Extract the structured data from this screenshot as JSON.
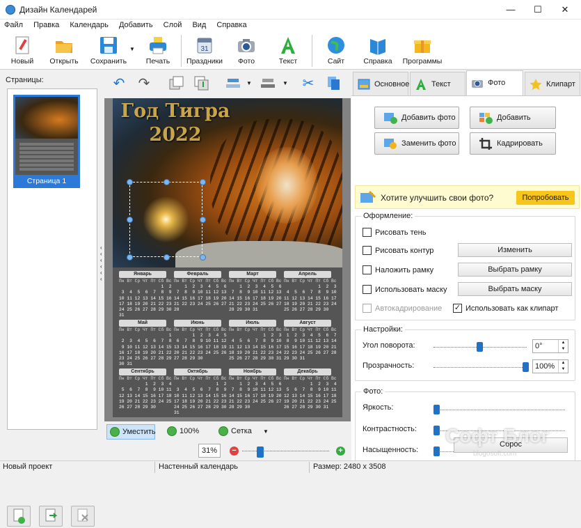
{
  "window": {
    "title": "Дизайн Календарей",
    "minimize": "—",
    "maximize": "☐",
    "close": "✕"
  },
  "menu": [
    "Файл",
    "Правка",
    "Календарь",
    "Добавить",
    "Слой",
    "Вид",
    "Справка"
  ],
  "toolbar": {
    "new": "Новый",
    "open": "Открыть",
    "save": "Сохранить",
    "print": "Печать",
    "holidays": "Праздники",
    "photo": "Фото",
    "text": "Текст",
    "site": "Сайт",
    "help": "Справка",
    "programs": "Программы",
    "holidays_icon_num": "31"
  },
  "pages": {
    "label": "Страницы:",
    "items": [
      {
        "label": "Страница 1"
      }
    ]
  },
  "poster": {
    "title_line1": "Год Тигра",
    "title_line2": "2022"
  },
  "calendar": {
    "weekday_header": "Пн Вт Ср Чт Пт Сб Вс",
    "months": [
      {
        "name": "Январь",
        "days": "                1  2\n 3  4  5  6  7  8  9\n10 11 12 13 14 15 16\n17 18 19 20 21 22 23\n24 25 26 27 28 29 30\n31"
      },
      {
        "name": "Февраль",
        "days": "    1  2  3  4  5  6\n 7  8  9 10 11 12 13\n14 15 16 17 18 19 20\n21 22 23 24 25 26 27\n28"
      },
      {
        "name": "Март",
        "days": "    1  2  3  4  5  6\n 7  8  9 10 11 12 13\n14 15 16 17 18 19 20\n21 22 23 24 25 26 27\n28 29 30 31"
      },
      {
        "name": "Апрель",
        "days": "             1  2  3\n 4  5  6  7  8  9 10\n11 12 13 14 15 16 17\n18 19 20 21 22 23 24\n25 26 27 28 29 30"
      },
      {
        "name": "Май",
        "days": "                   1\n 2  3  4  5  6  7  8\n 9 10 11 12 13 14 15\n16 17 18 19 20 21 22\n23 24 25 26 27 28 29\n30 31"
      },
      {
        "name": "Июнь",
        "days": "       1  2  3  4  5\n 6  7  8  9 10 11 12\n13 14 15 16 17 18 19\n20 21 22 23 24 25 26\n27 28 29 30"
      },
      {
        "name": "Июль",
        "days": "             1  2  3\n 4  5  6  7  8  9 10\n11 12 13 14 15 16 17\n18 19 20 21 22 23 24\n25 26 27 28 29 30 31"
      },
      {
        "name": "Август",
        "days": " 1  2  3  4  5  6  7\n 8  9 10 11 12 13 14\n15 16 17 18 19 20 21\n22 23 24 25 26 27 28\n29 30 31"
      },
      {
        "name": "Сентябрь",
        "days": "          1  2  3  4\n 5  6  7  8  9 10 11\n12 13 14 15 16 17 18\n19 20 21 22 23 24 25\n26 27 28 29 30"
      },
      {
        "name": "Октябрь",
        "days": "                1  2\n 3  4  5  6  7  8  9\n10 11 12 13 14 15 16\n17 18 19 20 21 22 23\n24 25 26 27 28 29 30\n31"
      },
      {
        "name": "Ноябрь",
        "days": "    1  2  3  4  5  6\n 7  8  9 10 11 12 13\n14 15 16 17 18 19 20\n21 22 23 24 25 26 27\n28 29 30"
      },
      {
        "name": "Декабрь",
        "days": "          1  2  3  4\n 5  6  7  8  9 10 11\n12 13 14 15 16 17 18\n19 20 21 22 23 24 25\n26 27 28 29 30 31"
      }
    ]
  },
  "canvas_bottom": {
    "fit": "Уместить",
    "zoom100": "100%",
    "grid": "Сетка",
    "zoom_value": "31%",
    "zoom_level_percent": 31
  },
  "tabs": {
    "basic": "Основное",
    "text": "Текст",
    "photo": "Фото",
    "clipart": "Клипарт",
    "active": "photo"
  },
  "photo_panel": {
    "add_photo": "Добавить фото",
    "add_collage": "Добавить коллаж",
    "replace_photo": "Заменить фото",
    "crop": "Кадрировать",
    "promo_text": "Хотите улучшить свои фото?",
    "promo_button": "Попробовать",
    "design": {
      "title": "Оформление:",
      "draw_shadow": "Рисовать тень",
      "draw_outline": "Рисовать контур",
      "change": "Изменить",
      "apply_frame": "Наложить рамку",
      "choose_frame": "Выбрать рамку",
      "use_mask": "Использовать маску",
      "choose_mask": "Выбрать маску",
      "autocrop": "Автокадрирование",
      "use_as_clipart": "Использовать как клипарт"
    },
    "settings": {
      "title": "Настройки:",
      "rotation_label": "Угол поворота:",
      "rotation_value": "0°",
      "rotation_fraction": 0.5,
      "opacity_label": "Прозрачность:",
      "opacity_value": "100%",
      "opacity_fraction": 1.0
    },
    "photo_adjust": {
      "title": "Фото:",
      "brightness": "Яркость:",
      "brightness_fraction": 0,
      "contrast": "Контрастность:",
      "contrast_fraction": 0,
      "saturation": "Насыщенность:",
      "saturation_fraction": 0,
      "reset": "Сброс"
    }
  },
  "status": {
    "project": "Новый проект",
    "type": "Настенный календарь",
    "size": "Размер: 2480 x 3508"
  },
  "watermark": {
    "text": "Софт Блог",
    "sub": "blogosoft.com"
  }
}
